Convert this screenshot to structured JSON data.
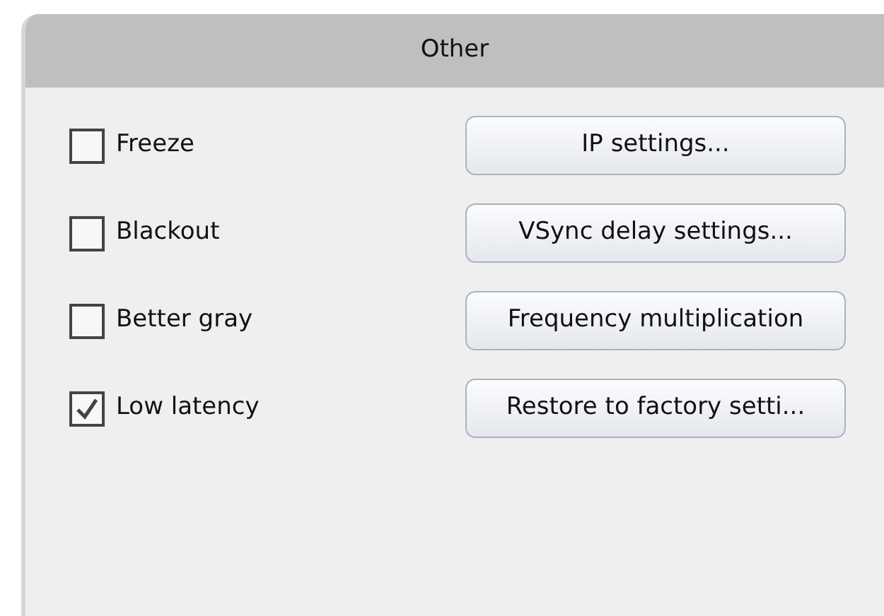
{
  "panel": {
    "title": "Other"
  },
  "rows": [
    {
      "checkbox": {
        "label": "Freeze",
        "checked": false
      },
      "button": "IP settings..."
    },
    {
      "checkbox": {
        "label": "Blackout",
        "checked": false
      },
      "button": "VSync delay settings..."
    },
    {
      "checkbox": {
        "label": "Better gray",
        "checked": false
      },
      "button": "Frequency multiplication"
    },
    {
      "checkbox": {
        "label": "Low latency",
        "checked": true
      },
      "button": "Restore to factory setti..."
    }
  ]
}
